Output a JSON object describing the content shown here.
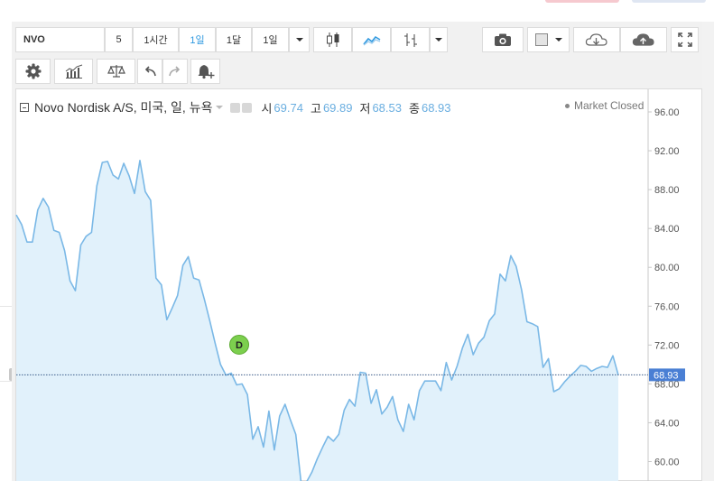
{
  "toolbar": {
    "symbol": "NVO",
    "intervals": [
      "5",
      "1시간",
      "1일",
      "1달",
      "1일"
    ],
    "active_interval_index": 2
  },
  "icons": [
    "candles-icon",
    "area-chart-icon",
    "bars-icon",
    "camera-icon",
    "color-box-icon",
    "cloud-download-icon",
    "cloud-upload-icon",
    "fullscreen-icon",
    "settings-icon",
    "indicators-icon",
    "compare-icon",
    "undo-icon",
    "redo-icon",
    "alert-icon"
  ],
  "legend": {
    "name": "Novo Nordisk A/S, 미국, 일, 뉴욕",
    "open_label": "시",
    "open_value": "69.74",
    "high_label": "고",
    "high_value": "69.89",
    "low_label": "저",
    "low_value": "68.53",
    "close_label": "종",
    "close_value": "68.93"
  },
  "market_status": "Market Closed",
  "event_marker": "D",
  "price_label": "68.93",
  "colors": {
    "line": "#7ab8e6",
    "area": "#e1f1fb",
    "accent": "#2f99e0",
    "marker": "#7ccf4e",
    "price_tag": "#4a7fd4"
  },
  "chart_data": {
    "type": "area",
    "ylim": [
      58,
      98
    ],
    "yticks": [
      "96.00",
      "92.00",
      "88.00",
      "84.00",
      "80.00",
      "76.00",
      "72.00",
      "68.00",
      "64.00",
      "60.00"
    ],
    "last_value": 68.93,
    "values": [
      85.4,
      84.4,
      82.6,
      82.6,
      85.9,
      87.1,
      86.2,
      83.8,
      83.6,
      81.7,
      78.6,
      77.6,
      82.3,
      83.2,
      83.6,
      88.4,
      90.8,
      90.9,
      89.5,
      89.1,
      90.7,
      89.4,
      87.6,
      91.0,
      87.8,
      86.9,
      78.9,
      78.2,
      74.6,
      75.8,
      77.1,
      80.2,
      81.1,
      78.9,
      78.7,
      76.7,
      74.5,
      72.2,
      70.0,
      68.9,
      69.1,
      67.9,
      68.0,
      66.9,
      62.3,
      63.6,
      61.5,
      65.2,
      61.2,
      64.7,
      65.9,
      64.3,
      62.8,
      57.8,
      57.9,
      58.9,
      60.3,
      61.5,
      62.6,
      62.1,
      62.8,
      65.3,
      66.4,
      65.7,
      69.2,
      69.1,
      66.0,
      67.4,
      64.9,
      65.6,
      66.7,
      64.3,
      63.1,
      65.9,
      64.3,
      67.3,
      68.3,
      68.3,
      68.3,
      67.3,
      70.2,
      68.4,
      69.8,
      71.7,
      73.1,
      71.0,
      72.2,
      72.8,
      74.5,
      75.2,
      79.3,
      78.6,
      81.2,
      80.1,
      77.7,
      74.4,
      74.2,
      73.9,
      69.7,
      70.6,
      67.2,
      67.5,
      68.2,
      68.8,
      69.3,
      69.9,
      69.8,
      69.3,
      69.6,
      69.8,
      69.7,
      70.9,
      68.9
    ]
  }
}
